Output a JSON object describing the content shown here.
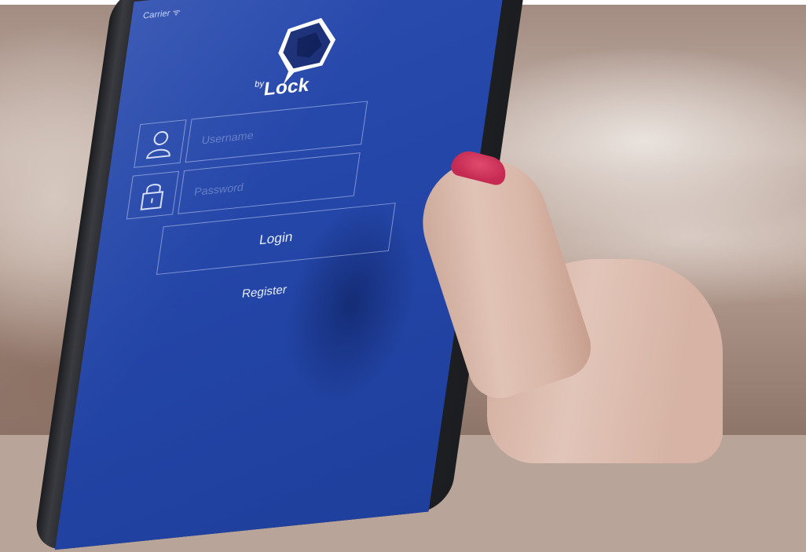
{
  "app": {
    "status_bar": "Carrier ᯤ",
    "logo_super": "by",
    "logo_name": "Lock"
  },
  "form": {
    "username_placeholder": "Username",
    "password_placeholder": "Password",
    "login_label": "Login",
    "register_label": "Register"
  },
  "colors": {
    "screen_blue": "#2446a8",
    "nail": "#c42a52"
  }
}
